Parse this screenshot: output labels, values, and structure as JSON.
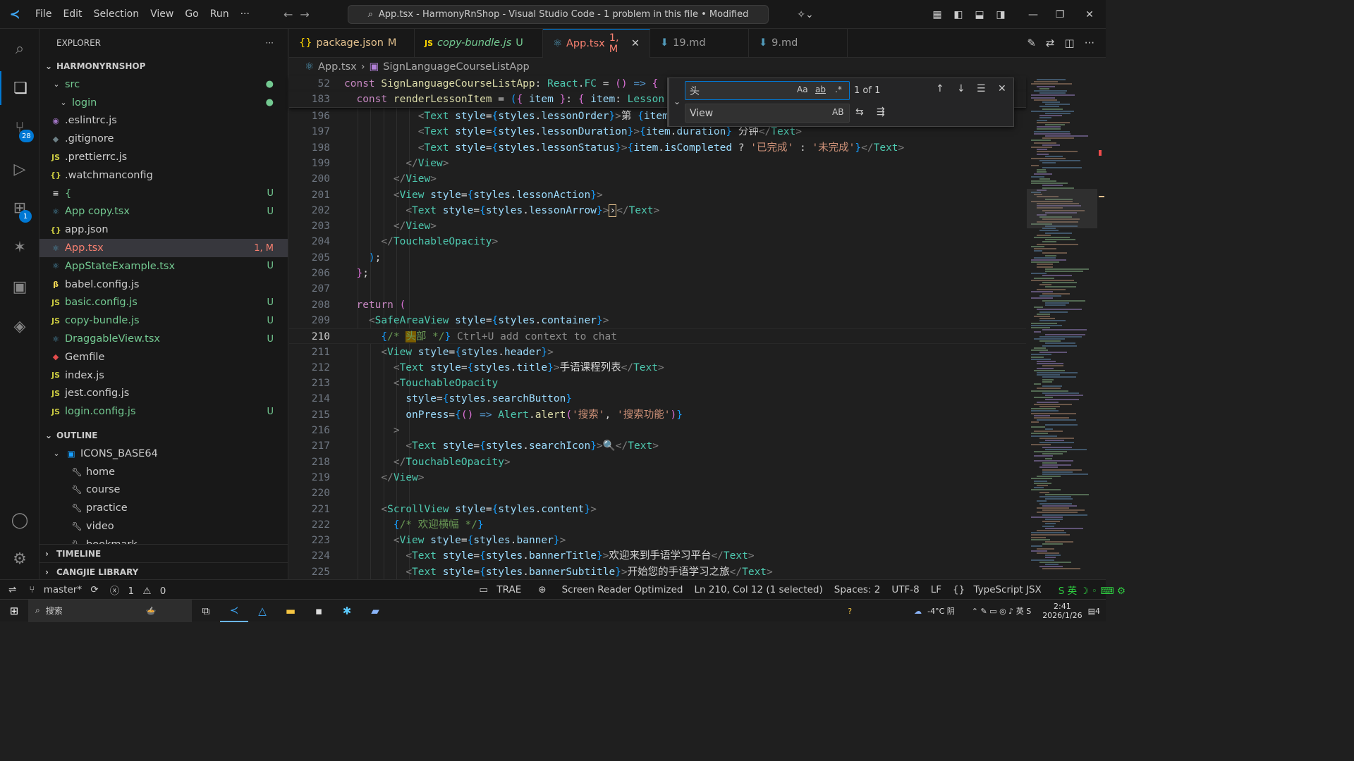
{
  "titlebar": {
    "menus": [
      "File",
      "Edit",
      "Selection",
      "View",
      "Go",
      "Run",
      "···"
    ],
    "command_center": "App.tsx - HarmonyRnShop - Visual Studio Code - 1 problem in this file • Modified"
  },
  "activity": {
    "scm_badge": "28",
    "ext_badge": "1"
  },
  "explorer": {
    "title": "EXPLORER",
    "more": "···",
    "root": "HARMONYRNSHOP",
    "src": "src",
    "login": "login",
    "files": [
      {
        "name": ".eslintrc.js",
        "icon": "◉",
        "status": ""
      },
      {
        "name": ".gitignore",
        "icon": "◆",
        "status": ""
      },
      {
        "name": ".prettierrc.js",
        "icon": "JS",
        "status": ""
      },
      {
        "name": ".watchmanconfig",
        "icon": "{}",
        "status": ""
      },
      {
        "name": "{",
        "icon": "≡",
        "status": "U"
      },
      {
        "name": "App copy.tsx",
        "icon": "⚛",
        "status": "U"
      },
      {
        "name": "app.json",
        "icon": "{}",
        "status": ""
      },
      {
        "name": "App.tsx",
        "icon": "⚛",
        "status": "1, M"
      },
      {
        "name": "AppStateExample.tsx",
        "icon": "⚛",
        "status": "U"
      },
      {
        "name": "babel.config.js",
        "icon": "β",
        "status": ""
      },
      {
        "name": "basic.config.js",
        "icon": "JS",
        "status": "U"
      },
      {
        "name": "copy-bundle.js",
        "icon": "JS",
        "status": "U"
      },
      {
        "name": "DraggableView.tsx",
        "icon": "⚛",
        "status": "U"
      },
      {
        "name": "Gemfile",
        "icon": "◆",
        "status": ""
      },
      {
        "name": "index.js",
        "icon": "JS",
        "status": ""
      },
      {
        "name": "jest.config.js",
        "icon": "JS",
        "status": ""
      },
      {
        "name": "login.config.js",
        "icon": "JS",
        "status": "U"
      }
    ],
    "outline_title": "OUTLINE",
    "outline_root": "ICONS_BASE64",
    "outline_items": [
      "home",
      "course",
      "practice",
      "video",
      "bookmark"
    ],
    "timeline": "TIMELINE",
    "cangjie": "CANGJIE LIBRARY"
  },
  "tabs": [
    {
      "icon": "{}",
      "label": "package.json",
      "status": "M"
    },
    {
      "icon": "JS",
      "label": "copy-bundle.js",
      "status": "U"
    },
    {
      "icon": "⚛",
      "label": "App.tsx",
      "status": "1, M"
    },
    {
      "icon": "⬇",
      "label": "19.md",
      "status": ""
    },
    {
      "icon": "⬇",
      "label": "9.md",
      "status": ""
    }
  ],
  "breadcrumb": {
    "file": "App.tsx",
    "symbol": "SignLanguageCourseListApp"
  },
  "find": {
    "search_value": "头",
    "replace_value": "View",
    "result": "1 of 1",
    "opt_case": "Aa",
    "opt_word": "ab",
    "opt_regex": ".*",
    "opt_preserve": "AB"
  },
  "status": {
    "branch": "master*",
    "errors": "1",
    "warnings": "0",
    "trae": "TRAE",
    "screen_reader": "Screen Reader Optimized",
    "position": "Ln 210, Col 12 (1 selected)",
    "spaces": "Spaces: 2",
    "encoding": "UTF-8",
    "eol": "LF",
    "language": "TypeScript JSX"
  },
  "taskbar": {
    "search": "搜索",
    "temp": "-4°C 阴",
    "time": "2:41",
    "date": "2026/1/26",
    "notif": "4"
  }
}
